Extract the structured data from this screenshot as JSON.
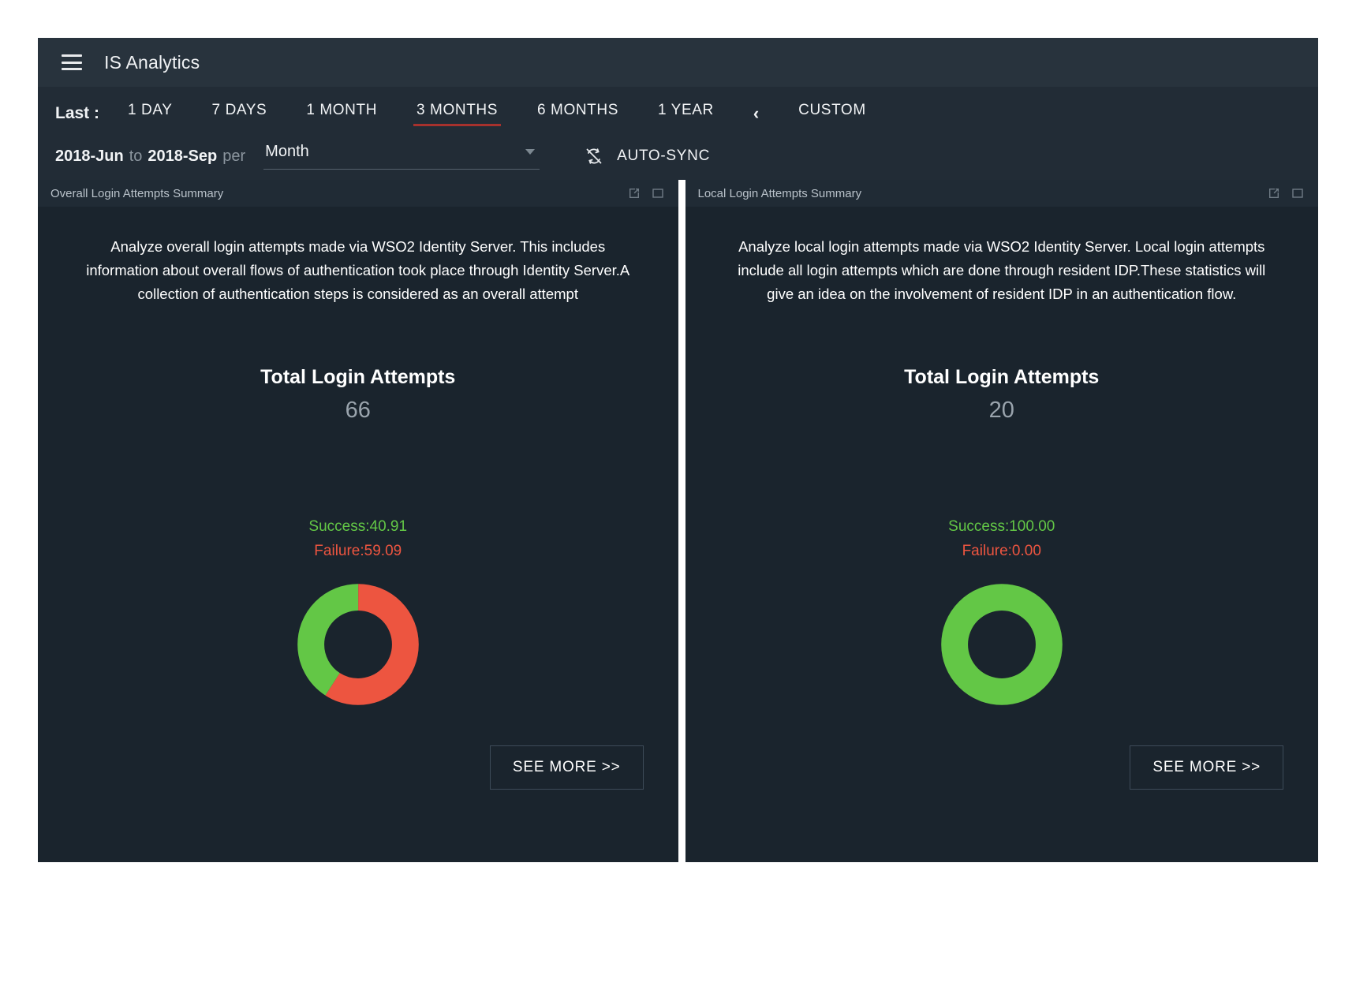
{
  "app": {
    "title": "IS Analytics",
    "menu_icon": "hamburger-menu-icon"
  },
  "timerange": {
    "label": "Last :",
    "options": [
      {
        "label": "1 DAY",
        "active": false
      },
      {
        "label": "7 DAYS",
        "active": false
      },
      {
        "label": "1 MONTH",
        "active": false
      },
      {
        "label": "3 MONTHS",
        "active": true
      },
      {
        "label": "6 MONTHS",
        "active": false
      },
      {
        "label": "1 YEAR",
        "active": false
      }
    ],
    "collapse_icon": "chevron-left-icon",
    "custom_label": "CUSTOM",
    "from": "2018-Jun",
    "to_label": "to",
    "to": "2018-Sep",
    "per_label": "per",
    "per_value": "Month",
    "autosync_label": "AUTO-SYNC",
    "autosync_icon": "sync-disabled-icon",
    "active_accent": "#a6312d"
  },
  "cards": [
    {
      "header": "Overall Login Attempts Summary",
      "description": "Analyze overall login attempts made via WSO2 Identity Server. This includes information about overall flows of authentication took place through Identity Server.A collection of authentication steps is considered as an overall attempt",
      "metric_title": "Total Login Attempts",
      "metric_value": "66",
      "success_label": "Success:40.91",
      "failure_label": "Failure:59.09",
      "see_more": "SEE MORE >>",
      "chart_data": {
        "type": "pie",
        "title": "Overall Login Attempts Summary",
        "categories": [
          "Success",
          "Failure"
        ],
        "values": [
          40.91,
          59.09
        ],
        "colors": [
          "#63c746",
          "#ed5540"
        ],
        "total": 66,
        "units": "percent",
        "legend": "above-chart"
      }
    },
    {
      "header": "Local Login Attempts Summary",
      "description": "Analyze local login attempts made via WSO2 Identity Server. Local login attempts include all login attempts which are done through resident IDP.These statistics will give an idea on the involvement of resident IDP in an authentication flow.",
      "metric_title": "Total Login Attempts",
      "metric_value": "20",
      "success_label": "Success:100.00",
      "failure_label": "Failure:0.00",
      "see_more": "SEE MORE >>",
      "chart_data": {
        "type": "pie",
        "title": "Local Login Attempts Summary",
        "categories": [
          "Success",
          "Failure"
        ],
        "values": [
          100.0,
          0.0
        ],
        "colors": [
          "#63c746",
          "#ed5540"
        ],
        "total": 20,
        "units": "percent",
        "legend": "above-chart"
      }
    }
  ],
  "card_icons": {
    "popout": "external-link-icon",
    "maximize": "maximize-icon"
  }
}
